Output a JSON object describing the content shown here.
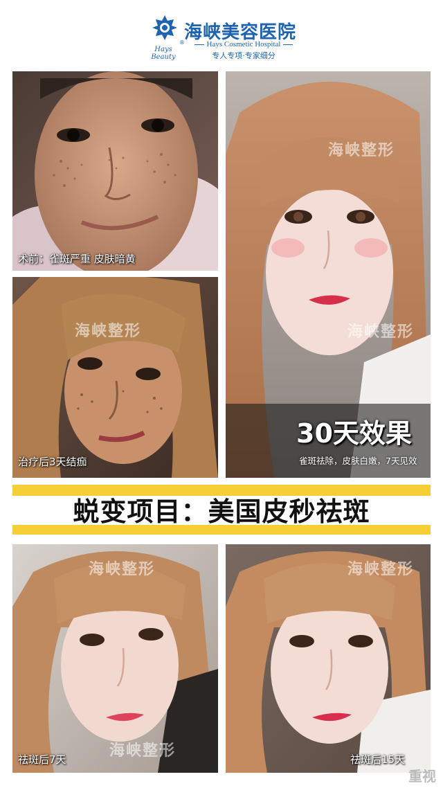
{
  "header": {
    "brand_cn": "海峡美容医院",
    "brand_en": "Hays Cosmetic Hospital",
    "tagline": "专人专项·专家细分",
    "script_logo": "Hays Beauty",
    "registered": "®"
  },
  "photos": [
    {
      "caption": "术前：雀斑严重 皮肤暗黄",
      "watermark": ""
    },
    {
      "caption": "治疗后3天结痂",
      "watermark": "海峡整形"
    },
    {
      "caption": "30天效果",
      "subcaption": "雀斑祛除，皮肤白嫩，7天见效",
      "watermark": "海峡整形",
      "watermark2": "海峡整形"
    },
    {
      "caption": "祛斑后7天",
      "watermark": "海峡整形",
      "watermark2": "海峡整形"
    },
    {
      "caption": "祛斑后15天",
      "watermark": "海峡整形"
    }
  ],
  "banner": {
    "text": "蜕变项目：美国皮秒祛斑"
  },
  "corner_mark": "重视",
  "colors": {
    "brand_blue": "#1e63b0",
    "banner_yellow": "#f5cf35"
  }
}
